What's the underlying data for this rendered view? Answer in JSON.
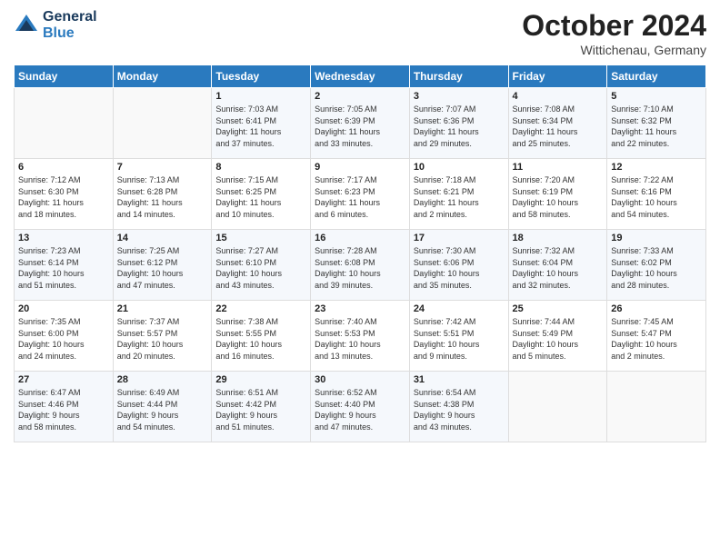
{
  "header": {
    "logo_line1": "General",
    "logo_line2": "Blue",
    "month": "October 2024",
    "location": "Wittichenau, Germany"
  },
  "days_of_week": [
    "Sunday",
    "Monday",
    "Tuesday",
    "Wednesday",
    "Thursday",
    "Friday",
    "Saturday"
  ],
  "weeks": [
    [
      {
        "day": "",
        "detail": ""
      },
      {
        "day": "",
        "detail": ""
      },
      {
        "day": "1",
        "detail": "Sunrise: 7:03 AM\nSunset: 6:41 PM\nDaylight: 11 hours\nand 37 minutes."
      },
      {
        "day": "2",
        "detail": "Sunrise: 7:05 AM\nSunset: 6:39 PM\nDaylight: 11 hours\nand 33 minutes."
      },
      {
        "day": "3",
        "detail": "Sunrise: 7:07 AM\nSunset: 6:36 PM\nDaylight: 11 hours\nand 29 minutes."
      },
      {
        "day": "4",
        "detail": "Sunrise: 7:08 AM\nSunset: 6:34 PM\nDaylight: 11 hours\nand 25 minutes."
      },
      {
        "day": "5",
        "detail": "Sunrise: 7:10 AM\nSunset: 6:32 PM\nDaylight: 11 hours\nand 22 minutes."
      }
    ],
    [
      {
        "day": "6",
        "detail": "Sunrise: 7:12 AM\nSunset: 6:30 PM\nDaylight: 11 hours\nand 18 minutes."
      },
      {
        "day": "7",
        "detail": "Sunrise: 7:13 AM\nSunset: 6:28 PM\nDaylight: 11 hours\nand 14 minutes."
      },
      {
        "day": "8",
        "detail": "Sunrise: 7:15 AM\nSunset: 6:25 PM\nDaylight: 11 hours\nand 10 minutes."
      },
      {
        "day": "9",
        "detail": "Sunrise: 7:17 AM\nSunset: 6:23 PM\nDaylight: 11 hours\nand 6 minutes."
      },
      {
        "day": "10",
        "detail": "Sunrise: 7:18 AM\nSunset: 6:21 PM\nDaylight: 11 hours\nand 2 minutes."
      },
      {
        "day": "11",
        "detail": "Sunrise: 7:20 AM\nSunset: 6:19 PM\nDaylight: 10 hours\nand 58 minutes."
      },
      {
        "day": "12",
        "detail": "Sunrise: 7:22 AM\nSunset: 6:16 PM\nDaylight: 10 hours\nand 54 minutes."
      }
    ],
    [
      {
        "day": "13",
        "detail": "Sunrise: 7:23 AM\nSunset: 6:14 PM\nDaylight: 10 hours\nand 51 minutes."
      },
      {
        "day": "14",
        "detail": "Sunrise: 7:25 AM\nSunset: 6:12 PM\nDaylight: 10 hours\nand 47 minutes."
      },
      {
        "day": "15",
        "detail": "Sunrise: 7:27 AM\nSunset: 6:10 PM\nDaylight: 10 hours\nand 43 minutes."
      },
      {
        "day": "16",
        "detail": "Sunrise: 7:28 AM\nSunset: 6:08 PM\nDaylight: 10 hours\nand 39 minutes."
      },
      {
        "day": "17",
        "detail": "Sunrise: 7:30 AM\nSunset: 6:06 PM\nDaylight: 10 hours\nand 35 minutes."
      },
      {
        "day": "18",
        "detail": "Sunrise: 7:32 AM\nSunset: 6:04 PM\nDaylight: 10 hours\nand 32 minutes."
      },
      {
        "day": "19",
        "detail": "Sunrise: 7:33 AM\nSunset: 6:02 PM\nDaylight: 10 hours\nand 28 minutes."
      }
    ],
    [
      {
        "day": "20",
        "detail": "Sunrise: 7:35 AM\nSunset: 6:00 PM\nDaylight: 10 hours\nand 24 minutes."
      },
      {
        "day": "21",
        "detail": "Sunrise: 7:37 AM\nSunset: 5:57 PM\nDaylight: 10 hours\nand 20 minutes."
      },
      {
        "day": "22",
        "detail": "Sunrise: 7:38 AM\nSunset: 5:55 PM\nDaylight: 10 hours\nand 16 minutes."
      },
      {
        "day": "23",
        "detail": "Sunrise: 7:40 AM\nSunset: 5:53 PM\nDaylight: 10 hours\nand 13 minutes."
      },
      {
        "day": "24",
        "detail": "Sunrise: 7:42 AM\nSunset: 5:51 PM\nDaylight: 10 hours\nand 9 minutes."
      },
      {
        "day": "25",
        "detail": "Sunrise: 7:44 AM\nSunset: 5:49 PM\nDaylight: 10 hours\nand 5 minutes."
      },
      {
        "day": "26",
        "detail": "Sunrise: 7:45 AM\nSunset: 5:47 PM\nDaylight: 10 hours\nand 2 minutes."
      }
    ],
    [
      {
        "day": "27",
        "detail": "Sunrise: 6:47 AM\nSunset: 4:46 PM\nDaylight: 9 hours\nand 58 minutes."
      },
      {
        "day": "28",
        "detail": "Sunrise: 6:49 AM\nSunset: 4:44 PM\nDaylight: 9 hours\nand 54 minutes."
      },
      {
        "day": "29",
        "detail": "Sunrise: 6:51 AM\nSunset: 4:42 PM\nDaylight: 9 hours\nand 51 minutes."
      },
      {
        "day": "30",
        "detail": "Sunrise: 6:52 AM\nSunset: 4:40 PM\nDaylight: 9 hours\nand 47 minutes."
      },
      {
        "day": "31",
        "detail": "Sunrise: 6:54 AM\nSunset: 4:38 PM\nDaylight: 9 hours\nand 43 minutes."
      },
      {
        "day": "",
        "detail": ""
      },
      {
        "day": "",
        "detail": ""
      }
    ]
  ]
}
